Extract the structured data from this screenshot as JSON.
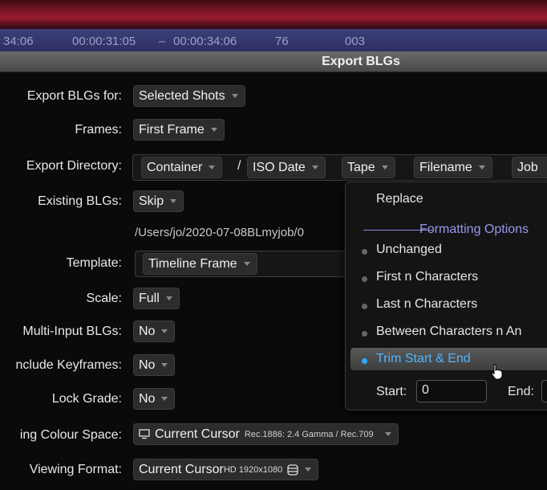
{
  "timecode_bar": {
    "tc1": "34:06",
    "tc2": "00:00:31:05",
    "dash": "–",
    "tc3": "00:00:34:06",
    "frames": "76",
    "shot": "003"
  },
  "dialog": {
    "title": "Export BLGs",
    "rows": {
      "export_for": {
        "label": "Export BLGs for:",
        "value": "Selected Shots"
      },
      "frames": {
        "label": "Frames:",
        "value": "First Frame"
      },
      "directory": {
        "label": "Export Directory:",
        "tokens": [
          "Container",
          "/",
          "ISO Date",
          "Tape",
          "Filename",
          "Job"
        ]
      },
      "existing": {
        "label": "Existing BLGs:",
        "value": "Skip"
      },
      "path": "/Users/jo/2020-07-08BLmyjob/0",
      "template": {
        "label": "Template:",
        "value": "Timeline Frame"
      },
      "scale": {
        "label": "Scale:",
        "value": "Full"
      },
      "multi_input": {
        "label": "Multi-Input BLGs:",
        "value": "No"
      },
      "include_keyframes": {
        "label": "nclude Keyframes:",
        "value": "No"
      },
      "lock_grade": {
        "label": "Lock Grade:",
        "value": "No"
      },
      "colour_space": {
        "label": "ing Colour Space:",
        "value": "Current Cursor",
        "detail": "Rec.1886: 2.4 Gamma / Rec.709",
        "icon": "monitor-icon"
      },
      "viewing_format": {
        "label": "Viewing Format:",
        "value": "Current Cursor",
        "detail": "HD 1920x1080",
        "icon": "database-icon"
      }
    }
  },
  "popup": {
    "replace": "Replace",
    "section": "Formatting Options",
    "options": [
      {
        "label": "Unchanged",
        "selected": false
      },
      {
        "label": "First n Characters",
        "selected": false
      },
      {
        "label": "Last n Characters",
        "selected": false
      },
      {
        "label": "Between Characters n An",
        "selected": false
      },
      {
        "label": "Trim Start & End",
        "selected": true
      }
    ],
    "start_label": "Start:",
    "start_value": "0",
    "end_label": "End:",
    "end_value": ""
  },
  "colors": {
    "accent_blue": "#2ea8ff",
    "section_purple": "#9898ee",
    "timecode_bg": "#34366e",
    "title_bg": "#5a5a5a"
  }
}
